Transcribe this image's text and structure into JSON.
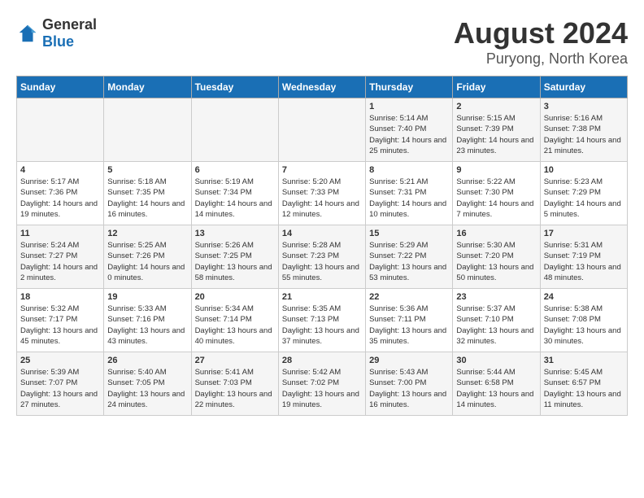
{
  "header": {
    "logo_general": "General",
    "logo_blue": "Blue",
    "month": "August 2024",
    "location": "Puryong, North Korea"
  },
  "days_of_week": [
    "Sunday",
    "Monday",
    "Tuesday",
    "Wednesday",
    "Thursday",
    "Friday",
    "Saturday"
  ],
  "weeks": [
    [
      {
        "day": "",
        "info": ""
      },
      {
        "day": "",
        "info": ""
      },
      {
        "day": "",
        "info": ""
      },
      {
        "day": "",
        "info": ""
      },
      {
        "day": "1",
        "info": "Sunrise: 5:14 AM\nSunset: 7:40 PM\nDaylight: 14 hours and 25 minutes."
      },
      {
        "day": "2",
        "info": "Sunrise: 5:15 AM\nSunset: 7:39 PM\nDaylight: 14 hours and 23 minutes."
      },
      {
        "day": "3",
        "info": "Sunrise: 5:16 AM\nSunset: 7:38 PM\nDaylight: 14 hours and 21 minutes."
      }
    ],
    [
      {
        "day": "4",
        "info": "Sunrise: 5:17 AM\nSunset: 7:36 PM\nDaylight: 14 hours and 19 minutes."
      },
      {
        "day": "5",
        "info": "Sunrise: 5:18 AM\nSunset: 7:35 PM\nDaylight: 14 hours and 16 minutes."
      },
      {
        "day": "6",
        "info": "Sunrise: 5:19 AM\nSunset: 7:34 PM\nDaylight: 14 hours and 14 minutes."
      },
      {
        "day": "7",
        "info": "Sunrise: 5:20 AM\nSunset: 7:33 PM\nDaylight: 14 hours and 12 minutes."
      },
      {
        "day": "8",
        "info": "Sunrise: 5:21 AM\nSunset: 7:31 PM\nDaylight: 14 hours and 10 minutes."
      },
      {
        "day": "9",
        "info": "Sunrise: 5:22 AM\nSunset: 7:30 PM\nDaylight: 14 hours and 7 minutes."
      },
      {
        "day": "10",
        "info": "Sunrise: 5:23 AM\nSunset: 7:29 PM\nDaylight: 14 hours and 5 minutes."
      }
    ],
    [
      {
        "day": "11",
        "info": "Sunrise: 5:24 AM\nSunset: 7:27 PM\nDaylight: 14 hours and 2 minutes."
      },
      {
        "day": "12",
        "info": "Sunrise: 5:25 AM\nSunset: 7:26 PM\nDaylight: 14 hours and 0 minutes."
      },
      {
        "day": "13",
        "info": "Sunrise: 5:26 AM\nSunset: 7:25 PM\nDaylight: 13 hours and 58 minutes."
      },
      {
        "day": "14",
        "info": "Sunrise: 5:28 AM\nSunset: 7:23 PM\nDaylight: 13 hours and 55 minutes."
      },
      {
        "day": "15",
        "info": "Sunrise: 5:29 AM\nSunset: 7:22 PM\nDaylight: 13 hours and 53 minutes."
      },
      {
        "day": "16",
        "info": "Sunrise: 5:30 AM\nSunset: 7:20 PM\nDaylight: 13 hours and 50 minutes."
      },
      {
        "day": "17",
        "info": "Sunrise: 5:31 AM\nSunset: 7:19 PM\nDaylight: 13 hours and 48 minutes."
      }
    ],
    [
      {
        "day": "18",
        "info": "Sunrise: 5:32 AM\nSunset: 7:17 PM\nDaylight: 13 hours and 45 minutes."
      },
      {
        "day": "19",
        "info": "Sunrise: 5:33 AM\nSunset: 7:16 PM\nDaylight: 13 hours and 43 minutes."
      },
      {
        "day": "20",
        "info": "Sunrise: 5:34 AM\nSunset: 7:14 PM\nDaylight: 13 hours and 40 minutes."
      },
      {
        "day": "21",
        "info": "Sunrise: 5:35 AM\nSunset: 7:13 PM\nDaylight: 13 hours and 37 minutes."
      },
      {
        "day": "22",
        "info": "Sunrise: 5:36 AM\nSunset: 7:11 PM\nDaylight: 13 hours and 35 minutes."
      },
      {
        "day": "23",
        "info": "Sunrise: 5:37 AM\nSunset: 7:10 PM\nDaylight: 13 hours and 32 minutes."
      },
      {
        "day": "24",
        "info": "Sunrise: 5:38 AM\nSunset: 7:08 PM\nDaylight: 13 hours and 30 minutes."
      }
    ],
    [
      {
        "day": "25",
        "info": "Sunrise: 5:39 AM\nSunset: 7:07 PM\nDaylight: 13 hours and 27 minutes."
      },
      {
        "day": "26",
        "info": "Sunrise: 5:40 AM\nSunset: 7:05 PM\nDaylight: 13 hours and 24 minutes."
      },
      {
        "day": "27",
        "info": "Sunrise: 5:41 AM\nSunset: 7:03 PM\nDaylight: 13 hours and 22 minutes."
      },
      {
        "day": "28",
        "info": "Sunrise: 5:42 AM\nSunset: 7:02 PM\nDaylight: 13 hours and 19 minutes."
      },
      {
        "day": "29",
        "info": "Sunrise: 5:43 AM\nSunset: 7:00 PM\nDaylight: 13 hours and 16 minutes."
      },
      {
        "day": "30",
        "info": "Sunrise: 5:44 AM\nSunset: 6:58 PM\nDaylight: 13 hours and 14 minutes."
      },
      {
        "day": "31",
        "info": "Sunrise: 5:45 AM\nSunset: 6:57 PM\nDaylight: 13 hours and 11 minutes."
      }
    ]
  ]
}
